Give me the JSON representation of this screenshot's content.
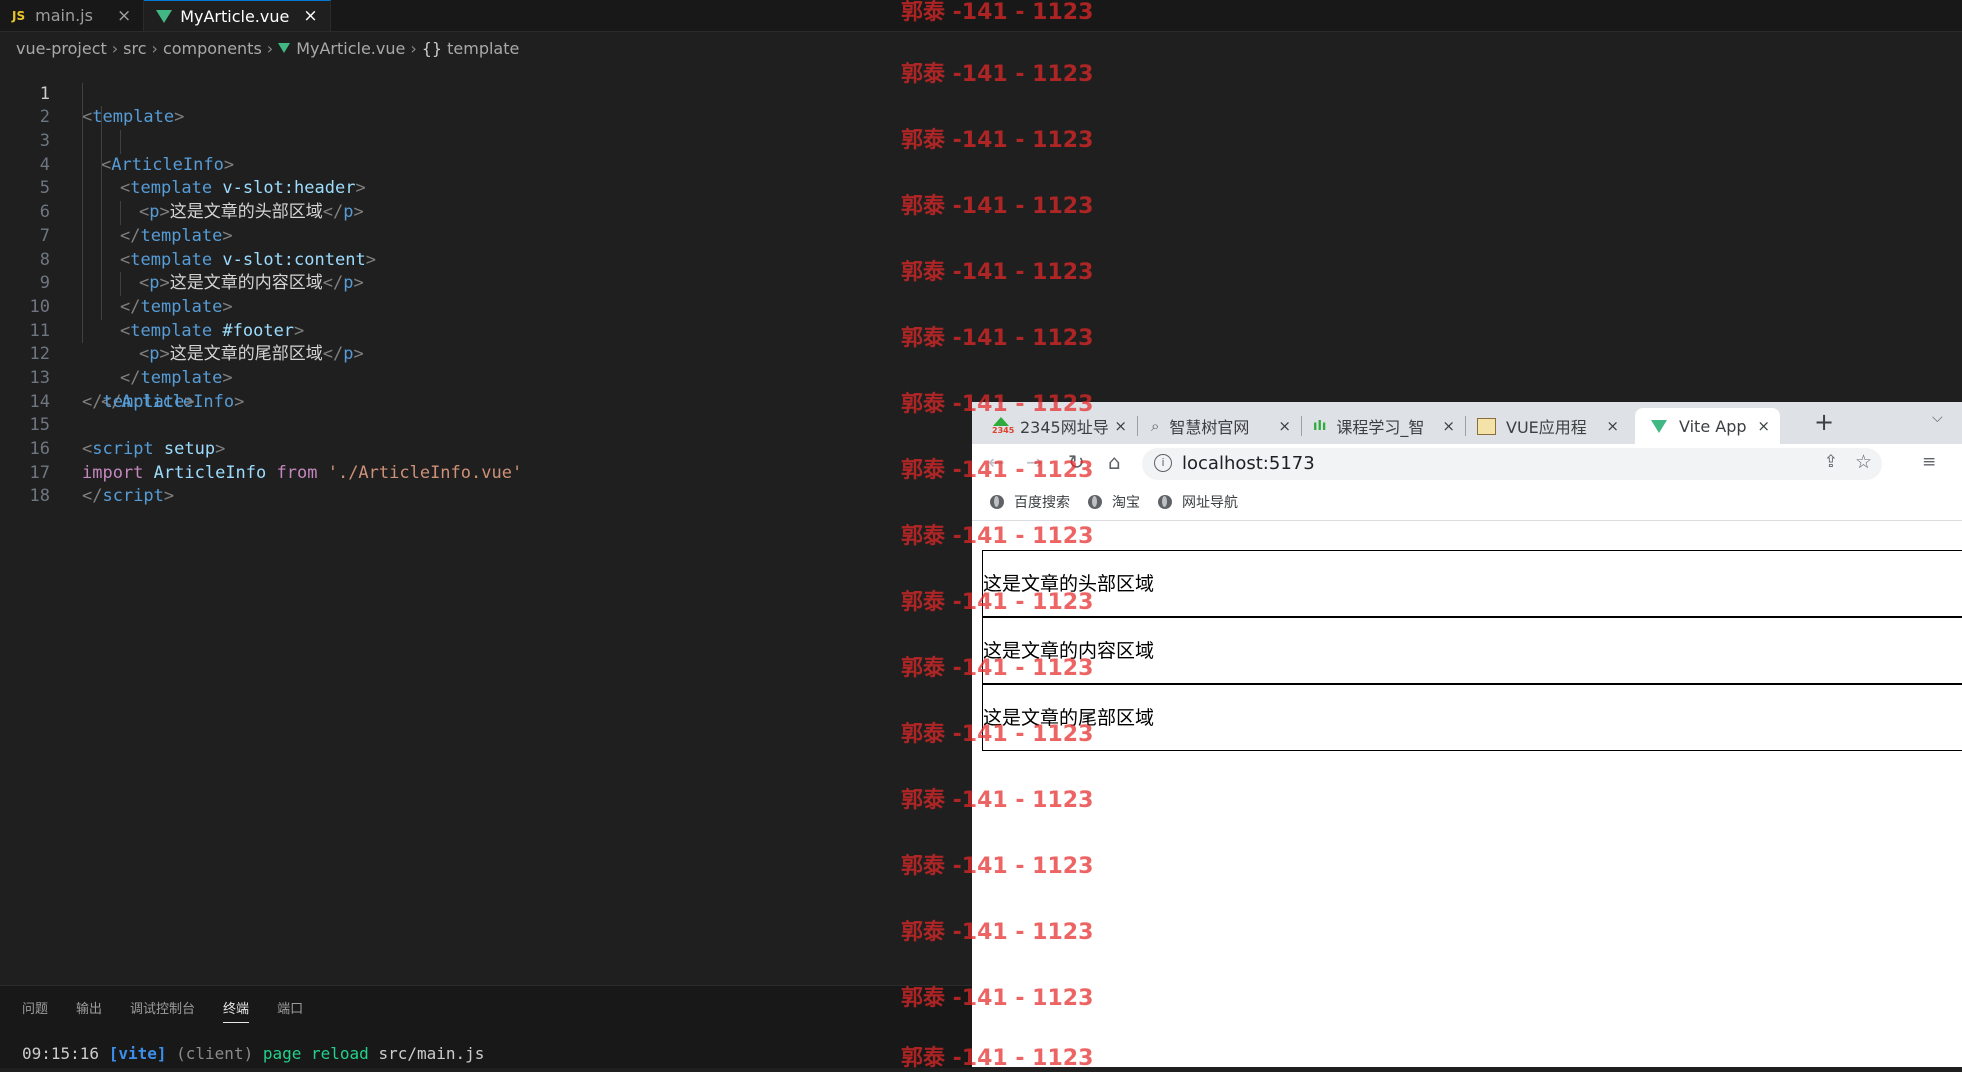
{
  "editor": {
    "tabs": [
      {
        "icon": "js-icon",
        "icon_text": "JS",
        "label": "main.js",
        "close": "×"
      },
      {
        "icon": "vue-icon",
        "label": "MyArticle.vue",
        "close": "×"
      }
    ],
    "breadcrumbs": [
      "vue-project",
      "src",
      "components",
      "MyArticle.vue",
      "template"
    ],
    "breadcrumb_braces": "{}",
    "crumb_sep": "›",
    "line_numbers": [
      "1",
      "2",
      "3",
      "4",
      "5",
      "6",
      "7",
      "8",
      "9",
      "10",
      "11",
      "12",
      "13",
      "14",
      "15",
      "16",
      "17",
      "18"
    ],
    "code": {
      "l1": {
        "open": "<",
        "tag": "template",
        "close": ">"
      },
      "l2": {
        "open": "<",
        "tag": "ArticleInfo",
        "close": ">"
      },
      "l3": {
        "open": "<",
        "tag": "template",
        "attr": "v-slot:header",
        "close": ">"
      },
      "l4": {
        "open": "<",
        "tag": "p",
        "close": ">",
        "text": "这是文章的头部区域",
        "end_open": "</",
        "end_tag": "p",
        "end_close": ">"
      },
      "l5": {
        "open": "</",
        "tag": "template",
        "close": ">"
      },
      "l6": {
        "open": "<",
        "tag": "template",
        "attr": "v-slot:content",
        "close": ">"
      },
      "l7": {
        "open": "<",
        "tag": "p",
        "close": ">",
        "text": "这是文章的内容区域",
        "end_open": "</",
        "end_tag": "p",
        "end_close": ">"
      },
      "l8": {
        "open": "</",
        "tag": "template",
        "close": ">"
      },
      "l9": {
        "open": "<",
        "tag": "template",
        "attr": "#footer",
        "close": ">"
      },
      "l10": {
        "open": "<",
        "tag": "p",
        "close": ">",
        "text": "这是文章的尾部区域",
        "end_open": "</",
        "end_tag": "p",
        "end_close": ">"
      },
      "l11": {
        "open": "</",
        "tag": "template",
        "close": ">"
      },
      "l12": {
        "open": "</",
        "tag": "ArticleInfo",
        "close": ">"
      },
      "l13": {
        "open": "</",
        "tag": "template",
        "close": ">"
      },
      "l15": {
        "open": "<",
        "tag": "script",
        "attr": "setup",
        "close": ">"
      },
      "l16": {
        "kw_import": "import",
        "ident": "ArticleInfo",
        "kw_from": "from",
        "str": "'./ArticleInfo.vue'"
      },
      "l17": {
        "open": "</",
        "tag": "script",
        "close": ">"
      }
    },
    "panel_tabs": [
      "问题",
      "输出",
      "调试控制台",
      "终端",
      "端口"
    ],
    "terminal": {
      "time": "09:15:16",
      "vite": "[vite]",
      "client": "(client)",
      "msg": "page reload",
      "file": "src/main.js"
    }
  },
  "browser": {
    "tabs": [
      {
        "label": "2345网址导",
        "close": "×"
      },
      {
        "label": "智慧树官网",
        "close": "×"
      },
      {
        "label": "课程学习_智",
        "close": "×"
      },
      {
        "label": "VUE应用程",
        "close": "×"
      },
      {
        "label": "Vite App",
        "close": "×"
      }
    ],
    "favicon_2345_text": "2345",
    "favicon_wave_text": "ılı",
    "new_tab": "+",
    "tab_strip_caret": "⌵",
    "nav": {
      "back": "←",
      "forward": "→",
      "reload": "↻",
      "home": "⌂"
    },
    "omnibox": {
      "info": "i",
      "url": "localhost:5173",
      "share": "⇪",
      "star": "☆"
    },
    "menu": "≡",
    "bookmarks": [
      "百度搜索",
      "淘宝",
      "网址导航"
    ],
    "page_boxes": [
      "这是文章的头部区域",
      "这是文章的内容区域",
      "这是文章的尾部区域"
    ]
  },
  "watermark": {
    "text": "郭泰 -141 - 1123",
    "color": "#e62828"
  }
}
